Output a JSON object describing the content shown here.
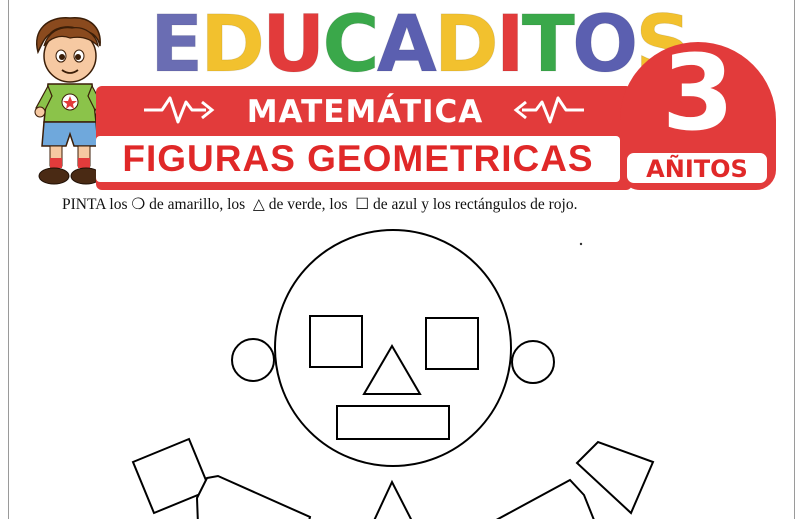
{
  "header": {
    "brand_letters": [
      {
        "char": "E",
        "color": "#6a6db3"
      },
      {
        "char": "D",
        "color": "#f2c12e"
      },
      {
        "char": "U",
        "color": "#e23b3b"
      },
      {
        "char": "C",
        "color": "#3aa84a"
      },
      {
        "char": "A",
        "color": "#5b5fb0"
      },
      {
        "char": "D",
        "color": "#f2c12e"
      },
      {
        "char": "I",
        "color": "#e23b3b"
      },
      {
        "char": "T",
        "color": "#3aa84a"
      },
      {
        "char": "O",
        "color": "#5b5fb0"
      },
      {
        "char": "S",
        "color": "#f2c12e"
      }
    ],
    "subject": "MATEMÁTICA",
    "topic": "FIGURAS GEOMETRICAS",
    "age_number": "3",
    "age_label": "AÑITOS",
    "accent_color": "#e23b3b"
  },
  "instruction": {
    "part1": "PINTA los ",
    "circle_symbol": "❍",
    "part2": " de amarillo, los  ",
    "triangle_symbol": "△",
    "part3": " de verde, los  ",
    "square_symbol": "☐",
    "part4": " de azul y los rectángulos de rojo."
  },
  "icons": {
    "mascot": "boy-mascot-icon",
    "heartbeat": "heartbeat-arrow-icon"
  }
}
